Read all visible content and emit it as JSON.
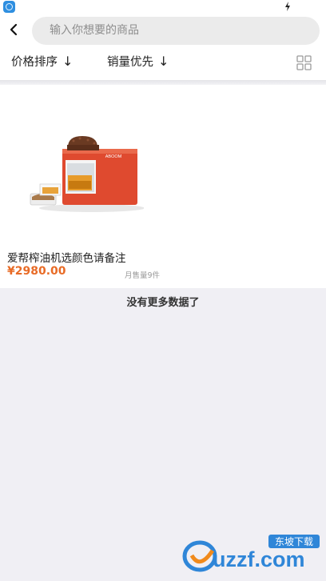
{
  "status_bar": {
    "app_icon": "browser-app-icon",
    "charging_icon": "lightning-icon"
  },
  "header": {
    "back_icon": "chevron-left-icon",
    "search_placeholder": "输入你想要的商品"
  },
  "sort_bar": {
    "price_label": "价格排序",
    "price_arrow": "↓",
    "sales_label": "销量优先",
    "sales_arrow": "↓",
    "view_toggle_icon": "grid-view-icon"
  },
  "products": [
    {
      "image_icon": "oil-press-machine-image",
      "image_brand": "ABOOM",
      "name": "爱帮榨油机选颜色请备注",
      "price": "¥2980.00",
      "monthly_sales": "月售量9件"
    }
  ],
  "footer_message": "没有更多数据了",
  "watermark": {
    "logo_text": "uzzf.com",
    "badge": "东坡下载"
  },
  "colors": {
    "price": "#e86b26",
    "background": "#f0eff4",
    "search_bg": "#ebebeb"
  }
}
